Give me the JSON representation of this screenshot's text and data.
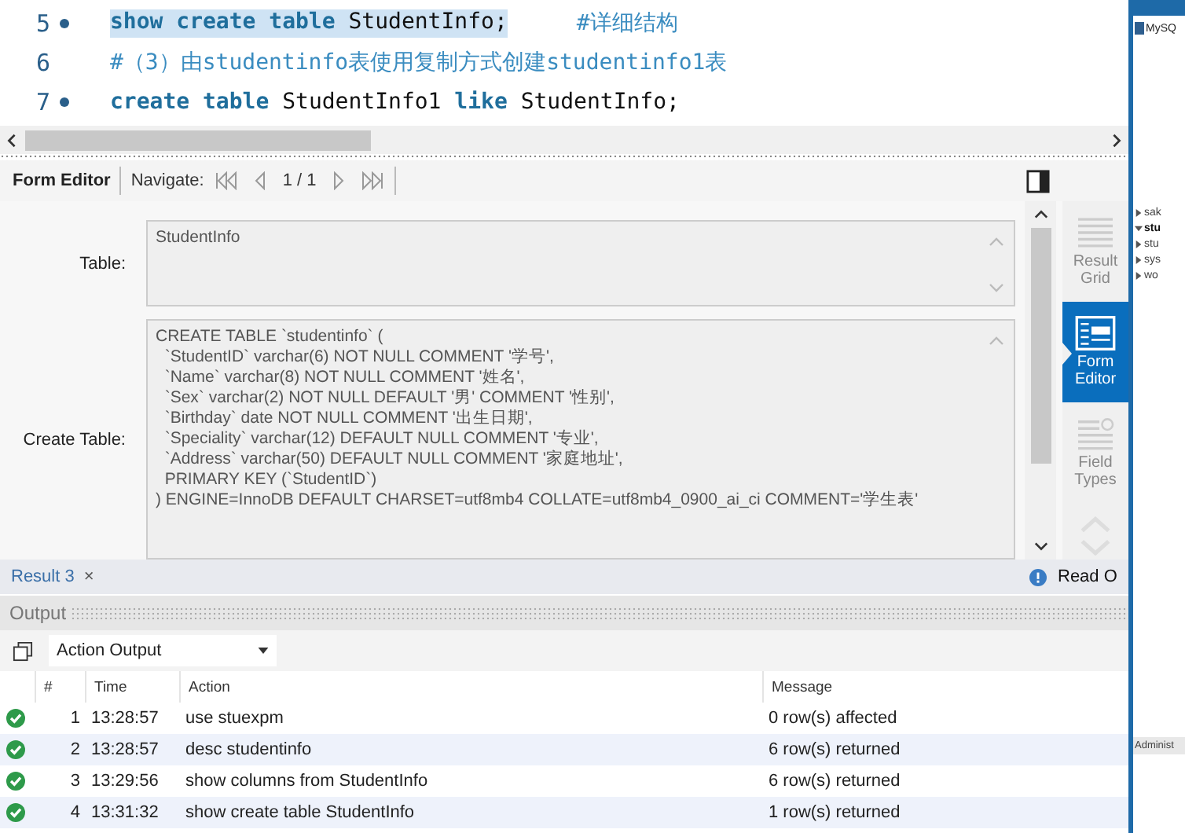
{
  "editor": {
    "lines": [
      {
        "number": "5",
        "statement_dot": true,
        "tokens": [
          {
            "kind": "keyword",
            "text": "show create table",
            "highlighted": true
          },
          {
            "kind": "ident",
            "text": " StudentInfo;",
            "highlighted": true
          },
          {
            "kind": "comment",
            "text": "#详细结构",
            "highlighted": false
          }
        ]
      },
      {
        "number": "6",
        "statement_dot": false,
        "tokens": [
          {
            "kind": "comment",
            "text": "#（3）由studentinfo表使用复制方式创建studentinfo1表",
            "highlighted": false
          }
        ]
      },
      {
        "number": "7",
        "statement_dot": true,
        "tokens": [
          {
            "kind": "keyword",
            "text": "create table",
            "highlighted": false
          },
          {
            "kind": "ident",
            "text": " StudentInfo1 ",
            "highlighted": false
          },
          {
            "kind": "keyword",
            "text": "like",
            "highlighted": false
          },
          {
            "kind": "ident",
            "text": " StudentInfo;",
            "highlighted": false
          }
        ]
      }
    ]
  },
  "toolbar": {
    "title": "Form Editor",
    "navigate_label": "Navigate:",
    "page": "1 / 1"
  },
  "form": {
    "fields": [
      {
        "label": "Table:",
        "value": "StudentInfo",
        "kind": "short"
      },
      {
        "label": "Create Table:",
        "value": "CREATE TABLE `studentinfo` (\n  `StudentID` varchar(6) NOT NULL COMMENT '学号',\n  `Name` varchar(8) NOT NULL COMMENT '姓名',\n  `Sex` varchar(2) NOT NULL DEFAULT '男' COMMENT '性别',\n  `Birthday` date NOT NULL COMMENT '出生日期',\n  `Speciality` varchar(12) DEFAULT NULL COMMENT '专业',\n  `Address` varchar(50) DEFAULT NULL COMMENT '家庭地址',\n  PRIMARY KEY (`StudentID`)\n) ENGINE=InnoDB DEFAULT CHARSET=utf8mb4 COLLATE=utf8mb4_0900_ai_ci COMMENT='学生表'",
        "kind": "tall"
      }
    ]
  },
  "side_tabs": [
    {
      "label": "Result Grid",
      "kind": "grid",
      "selected": false
    },
    {
      "label": "Form Editor",
      "kind": "form",
      "selected": true
    },
    {
      "label": "Field Types",
      "kind": "types",
      "selected": false
    }
  ],
  "result_tab": {
    "label": "Result 3",
    "close": "×",
    "status": "Read O"
  },
  "output": {
    "title": "Output",
    "dropdown": "Action Output",
    "columns": [
      "#",
      "Time",
      "Action",
      "Message"
    ],
    "rows": [
      {
        "kind": "success",
        "number": "1",
        "time": "13:28:57",
        "action": "use stuexpm",
        "message": "0 row(s) affected"
      },
      {
        "kind": "success",
        "number": "2",
        "time": "13:28:57",
        "action": "desc studentinfo",
        "message": "6 row(s) returned"
      },
      {
        "kind": "success",
        "number": "3",
        "time": "13:29:56",
        "action": "show columns from StudentInfo",
        "message": "6 row(s) returned"
      },
      {
        "kind": "success",
        "number": "4",
        "time": "13:31:32",
        "action": "show create table StudentInfo",
        "message": "1 row(s) returned"
      }
    ]
  },
  "second_window": {
    "title": "MySQ",
    "schemas": [
      {
        "label": "sak",
        "expanded": false
      },
      {
        "label": "stu",
        "expanded": true
      },
      {
        "label": "stu",
        "expanded": false
      },
      {
        "label": "sys",
        "expanded": false
      },
      {
        "label": "wo",
        "expanded": false
      }
    ],
    "bottom_tab": "Administ"
  }
}
